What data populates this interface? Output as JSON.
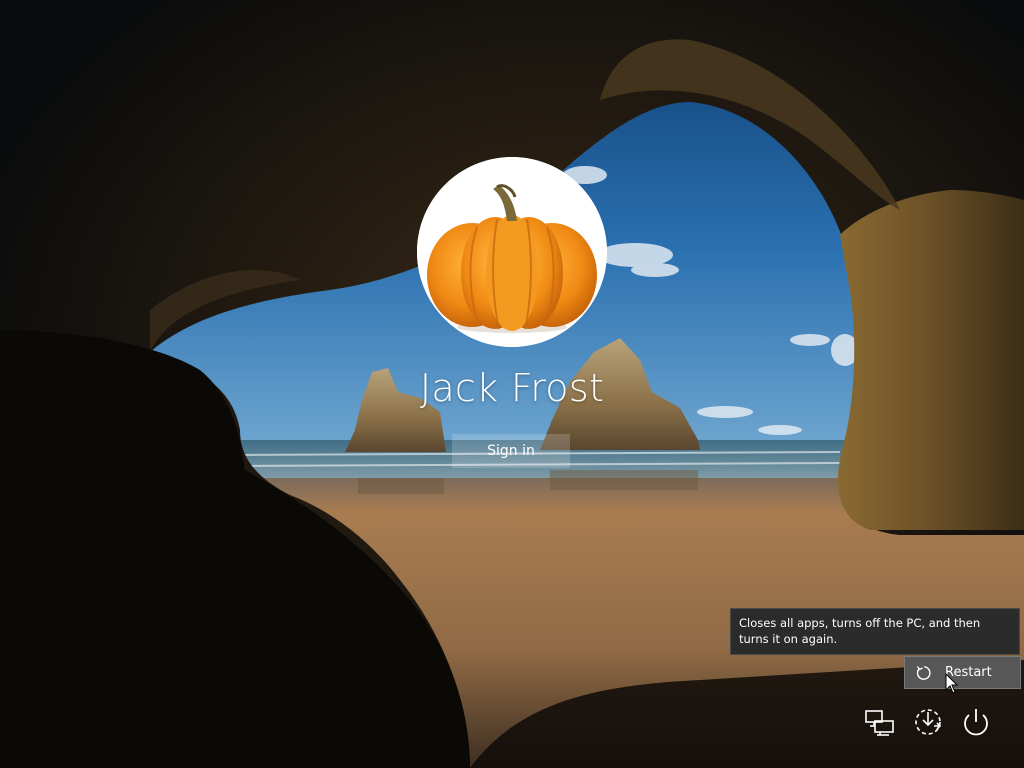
{
  "lock_screen": {
    "user_name": "Jack Frost",
    "sign_in_label": "Sign in",
    "avatar_icon": "pumpkin-icon"
  },
  "tooltip": {
    "text": "Closes all apps, turns off the PC, and then turns it on again."
  },
  "power_menu": {
    "restart_label": "Restart"
  },
  "bottom_icons": [
    "network-icon",
    "ease-of-access-icon",
    "power-icon"
  ],
  "colors": {
    "tooltip_bg": "#2b2b2b",
    "menu_item_bg": "#575757",
    "sky": "#1d5f9c",
    "sand": "#9a7048"
  }
}
